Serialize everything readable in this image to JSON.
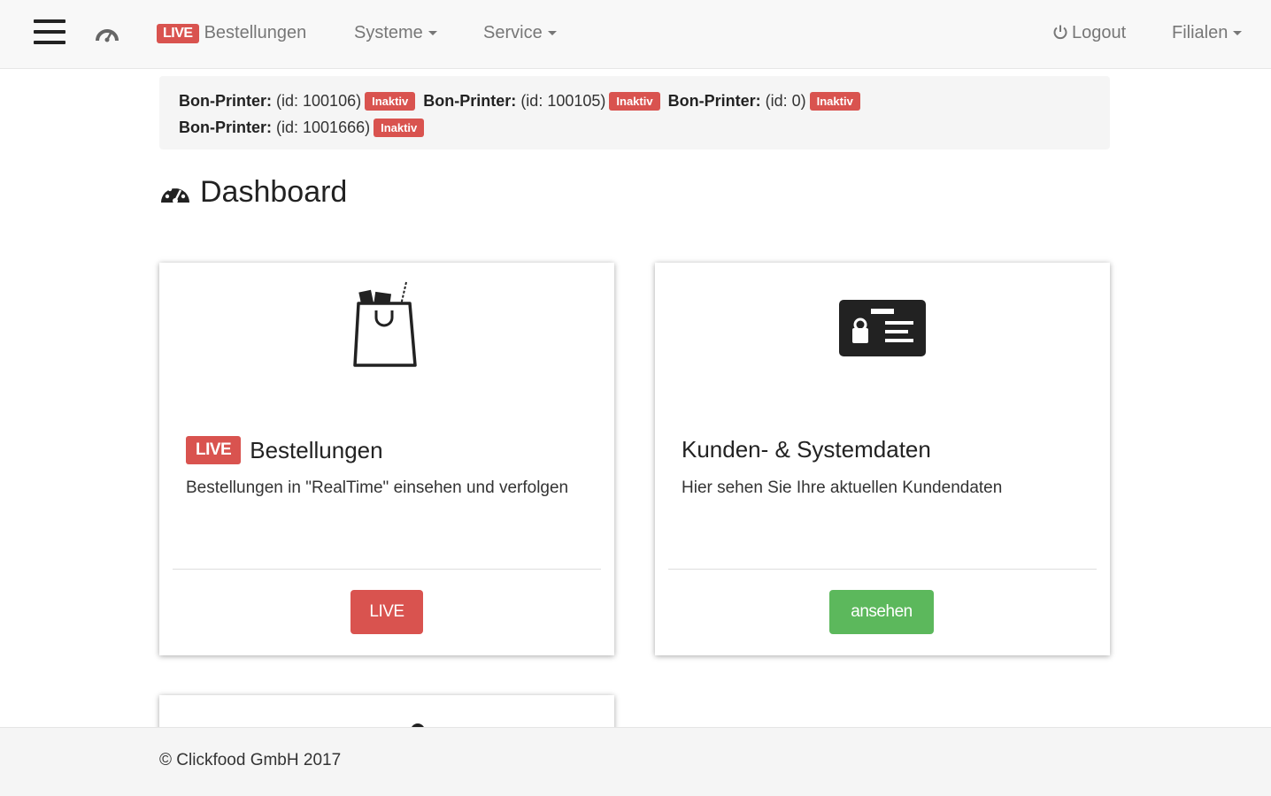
{
  "navbar": {
    "menu_icon": "hamburger-menu-icon",
    "dashboard_icon": "dashboard-gauge-icon",
    "live_badge": "LIVE",
    "orders_label": "Bestellungen",
    "systems_label": "Systeme",
    "service_label": "Service",
    "logout_label": "Logout",
    "logout_icon": "power-icon",
    "branches_label": "Filialen"
  },
  "printers": {
    "items": [
      {
        "name": "Bon-Printer:",
        "id": "(id: 100106)",
        "status": "Inaktiv"
      },
      {
        "name": "Bon-Printer:",
        "id": "(id: 100105)",
        "status": "Inaktiv"
      },
      {
        "name": "Bon-Printer:",
        "id": "(id: 0)",
        "status": "Inaktiv"
      },
      {
        "name": "Bon-Printer:",
        "id": "(id: 1001666)",
        "status": "Inaktiv"
      }
    ]
  },
  "page": {
    "title": "Dashboard",
    "title_icon": "dashboard-gauge-icon"
  },
  "cards": [
    {
      "icon": "shopping-bag-icon",
      "badge": "LIVE",
      "title": "Bestellungen",
      "text": "Bestellungen in \"RealTime\" einsehen und verfolgen",
      "button": "LIVE"
    },
    {
      "icon": "id-card-icon",
      "title": "Kunden- & Systemdaten",
      "text": "Hier sehen Sie Ihre aktuellen Kundendaten",
      "button": "ansehen"
    }
  ],
  "footer": {
    "copyright": "© Clickfood GmbH 2017"
  },
  "colors": {
    "danger": "#d9534f",
    "success": "#5cb85c",
    "navbar_bg": "#f8f8f8"
  }
}
